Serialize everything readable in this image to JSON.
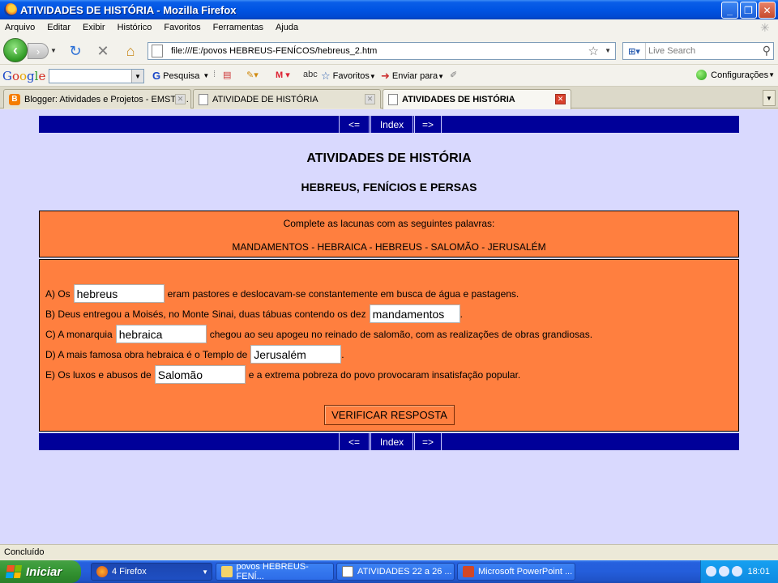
{
  "window": {
    "title": "ATIVIDADES DE HISTÓRIA - Mozilla Firefox"
  },
  "menu": [
    "Arquivo",
    "Editar",
    "Exibir",
    "Histórico",
    "Favoritos",
    "Ferramentas",
    "Ajuda"
  ],
  "navbar": {
    "url": "file:///E:/povos HEBREUS-FENÍCOS/hebreus_2.htm",
    "search_placeholder": "Live Search"
  },
  "google_toolbar": {
    "logo": "Google",
    "search_label": "Pesquisa",
    "favorites_label": "Favoritos",
    "send_label": "Enviar para",
    "settings_label": "Configurações"
  },
  "tabs": [
    {
      "label": "Blogger: Atividades e Projetos - EMST -..."
    },
    {
      "label": "ATIVIDADE DE HISTÓRIA"
    },
    {
      "label": "ATIVIDADES DE HISTÓRIA"
    }
  ],
  "page": {
    "nav": {
      "prev": "<=",
      "index": "Index",
      "next": "=>"
    },
    "title": "ATIVIDADES DE HISTÓRIA",
    "subtitle": "HEBREUS, FENÍCIOS E PERSAS",
    "instructions": "Complete as lacunas com as seguintes palavras:",
    "words": "MANDAMENTOS - HEBRAICA - HEBREUS - SALOMÃO - JERUSALÉM",
    "questions": [
      {
        "before": "A) Os",
        "answer": "hebreus",
        "after": "eram pastores e deslocavam-se constantemente em busca de água e pastagens."
      },
      {
        "before": "B) Deus entregou a Moisés, no Monte Sinai, duas tábuas contendo os dez",
        "answer": "mandamentos",
        "after": "."
      },
      {
        "before": "C) A monarquia",
        "answer": "hebraica",
        "after": "chegou ao seu apogeu no reinado de salomão, com as realizações de obras grandiosas."
      },
      {
        "before": "D) A mais famosa obra hebraica é o Templo de",
        "answer": "Jerusalém",
        "after": "."
      },
      {
        "before": "E) Os luxos e abusos de",
        "answer": "Salomão",
        "after": "e a extrema pobreza do povo provocaram insatisfação popular."
      }
    ],
    "verify_button": "VERIFICAR RESPOSTA"
  },
  "status": "Concluído",
  "taskbar": {
    "start": "Iniciar",
    "buttons": [
      {
        "label": "4 Firefox"
      },
      {
        "label": "povos HEBREUS-FENÍ..."
      },
      {
        "label": "ATIVIDADES 22 a 26 ..."
      },
      {
        "label": "Microsoft PowerPoint ..."
      }
    ],
    "clock": "18:01"
  },
  "colors": {
    "page_background": "#d9d9fe",
    "nav_strip": "#000099",
    "box_fill": "#ff7f3f"
  }
}
